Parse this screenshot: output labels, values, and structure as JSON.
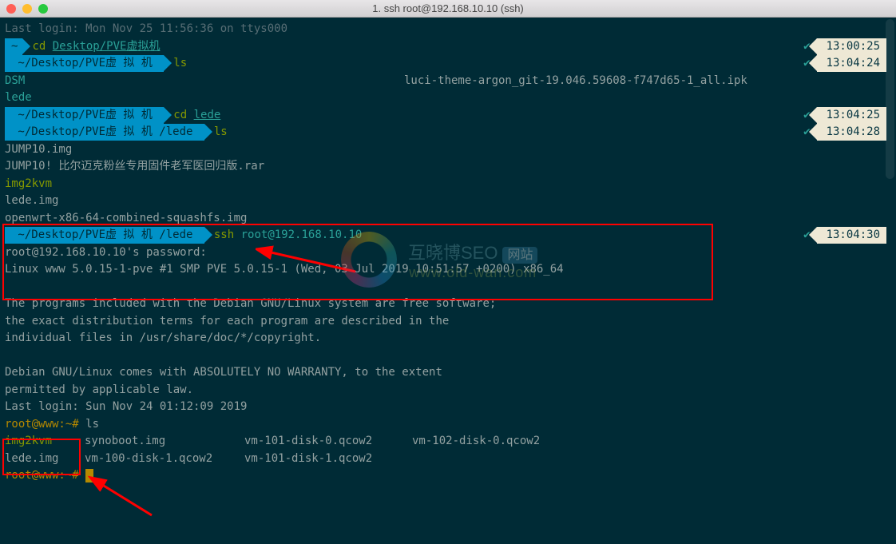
{
  "window": {
    "title": "1. ssh root@192.168.10.10 (ssh)"
  },
  "colors": {
    "promptbg": "#0092c7",
    "termbg": "#002b36",
    "cmd": "#859900"
  },
  "lastLoginLocal": "Last login: Mon Nov 25 11:56:36 on ttys000",
  "prompts": {
    "home": "~",
    "pve": " ~/Desktop/PVE虚 拟 机 ",
    "lede": " ~/Desktop/PVE虚 拟 机 /lede "
  },
  "cmds": {
    "cd_pve_cmd": "cd",
    "cd_pve_arg": "Desktop/PVE虚拟机",
    "ls": "ls",
    "cd_lede_cmd": "cd",
    "cd_lede_arg": "lede",
    "ssh_cmd": "ssh",
    "ssh_arg": "root@192.168.10.10",
    "remote_ls": "ls"
  },
  "times": {
    "t1": "13:00:25",
    "t2": "13:04:24",
    "t3": "13:04:25",
    "t4": "13:04:28",
    "t5": "13:04:30"
  },
  "ls_pve": {
    "col1a": "DSM",
    "col1b": "lede",
    "col2a": "luci-theme-argon_git-19.046.59608-f747d65-1_all.ipk"
  },
  "ls_lede": [
    "JUMP10.img",
    "JUMP10! 比尔迈克粉丝专用固件老军医回归版.rar",
    "img2kvm",
    "lede.img",
    "openwrt-x86-64-combined-squashfs.img"
  ],
  "ssh_output": {
    "pwprompt": "root@192.168.10.10's password:",
    "uname": "Linux www 5.0.15-1-pve #1 SMP PVE 5.0.15-1 (Wed, 03 Jul 2019 10:51:57 +0200) x86_64",
    "motd1": "The programs included with the Debian GNU/Linux system are free software;",
    "motd2": "the exact distribution terms for each program are described in the",
    "motd3": "individual files in /usr/share/doc/*/copyright.",
    "motd4": "Debian GNU/Linux comes with ABSOLUTELY NO WARRANTY, to the extent",
    "motd5": "permitted by applicable law.",
    "lastlogin": "Last login: Sun Nov 24 01:12:09 2019",
    "remote_prompt": "root@www:~#"
  },
  "remote_ls": {
    "r1c1": "img2kvm",
    "r1c2": "synoboot.img",
    "r1c3": "vm-101-disk-0.qcow2",
    "r1c4": "vm-102-disk-0.qcow2",
    "r2c1": "lede.img",
    "r2c2": "vm-100-disk-1.qcow2",
    "r2c3": "vm-101-disk-1.qcow2"
  },
  "watermark": {
    "text1": "互晓博SEO",
    "badge": "网站",
    "text2": "www.old-wan.com"
  }
}
